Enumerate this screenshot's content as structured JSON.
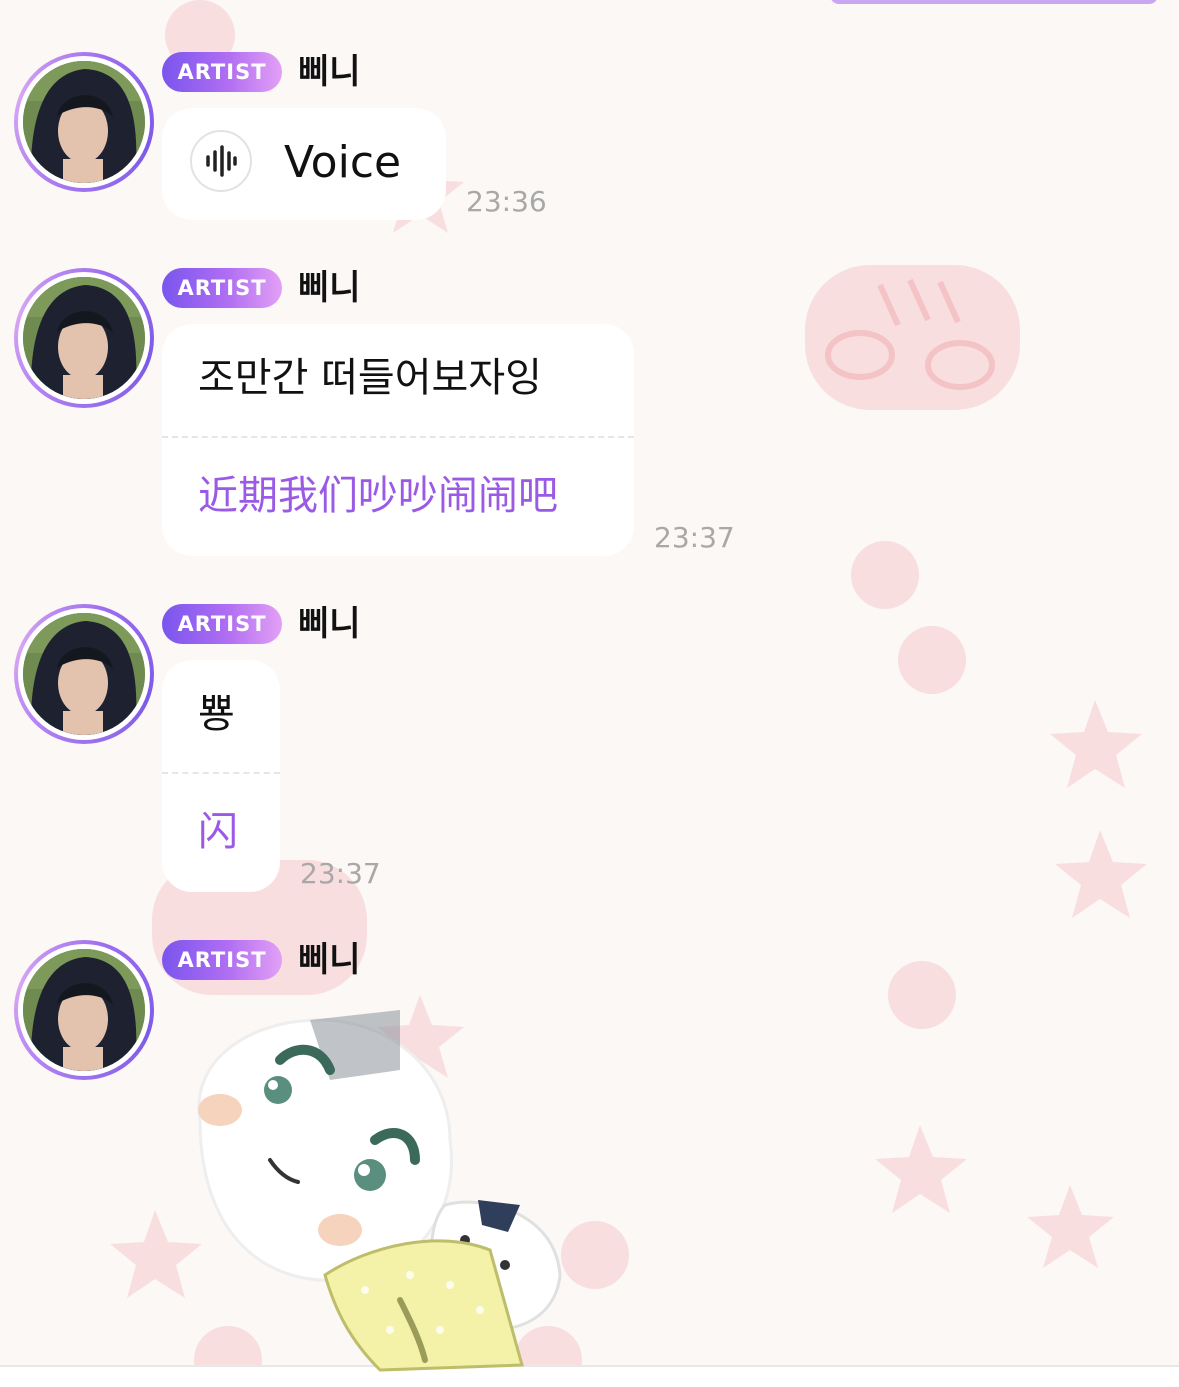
{
  "messages": [
    {
      "badge": "ARTIST",
      "sender": "삐니",
      "type": "voice",
      "voice_label": "Voice",
      "time": "23:36"
    },
    {
      "badge": "ARTIST",
      "sender": "삐니",
      "type": "text",
      "original": "조만간 떠들어보자잉",
      "translation": "近期我们吵吵闹闹吧",
      "time": "23:37"
    },
    {
      "badge": "ARTIST",
      "sender": "삐니",
      "type": "text",
      "original": "뿅",
      "translation": "闪",
      "time": "23:37"
    },
    {
      "badge": "ARTIST",
      "sender": "삐니",
      "type": "sticker",
      "sticker_icon": "rice-ball-sticker"
    }
  ],
  "colors": {
    "badge_start": "#7a55ee",
    "badge_end": "#e3a0f6",
    "translation_text": "#9a5ae6",
    "timestamp": "#a8a8a8",
    "bubble": "#ffffff",
    "background": "#fbf8f6"
  },
  "icons": {
    "voice": "waveform-icon",
    "avatar": "avatar-photo"
  }
}
